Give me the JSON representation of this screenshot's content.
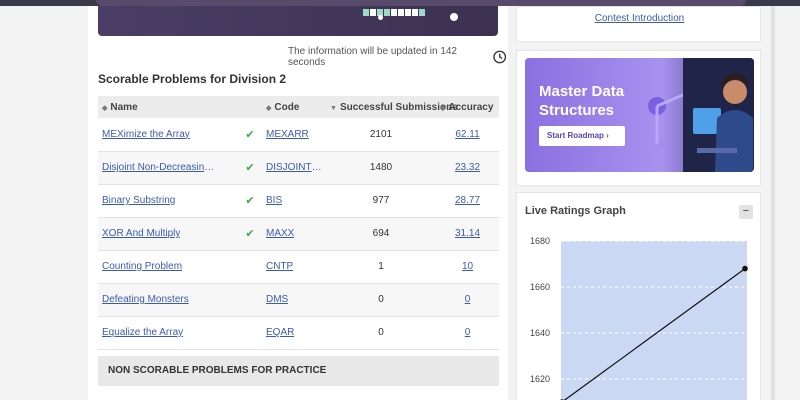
{
  "update_info": {
    "prefix": "The information will be updated in ",
    "seconds": "142",
    "suffix": " seconds"
  },
  "section_title": "Scorable Problems for Division 2",
  "table": {
    "headers": [
      "Name",
      "Code",
      "Successful Submissions",
      "Accuracy"
    ],
    "rows": [
      {
        "name": "MEXimize the Array",
        "solved": true,
        "code": "MEXARR",
        "submissions": "2101",
        "accuracy": "62.11"
      },
      {
        "name": "Disjoint Non-Decreasing Subsequences",
        "solved": true,
        "code": "DISJOINTNDS",
        "submissions": "1480",
        "accuracy": "23.32"
      },
      {
        "name": "Binary Substring",
        "solved": true,
        "code": "BIS",
        "submissions": "977",
        "accuracy": "28.77"
      },
      {
        "name": "XOR And Multiply",
        "solved": true,
        "code": "MAXX",
        "submissions": "694",
        "accuracy": "31.14"
      },
      {
        "name": "Counting Problem",
        "solved": false,
        "code": "CNTP",
        "submissions": "1",
        "accuracy": "10"
      },
      {
        "name": "Defeating Monsters",
        "solved": false,
        "code": "DMS",
        "submissions": "0",
        "accuracy": "0"
      },
      {
        "name": "Equalize the Array",
        "solved": false,
        "code": "EQAR",
        "submissions": "0",
        "accuracy": "0"
      }
    ]
  },
  "check_icon": "check-icon",
  "non_scorable_title": "NON SCORABLE PROBLEMS FOR PRACTICE",
  "contest_link": "Contest Introduction",
  "promo": {
    "title": "Master Data Structures",
    "button": "Start Roadmap"
  },
  "graph": {
    "title": "Live Ratings Graph",
    "toggle": "−",
    "y_ticks": [
      "1680",
      "1660",
      "1640",
      "1620"
    ],
    "y_min": 1600,
    "y_max": 1680,
    "points": [
      1610,
      1668
    ]
  },
  "colors": {
    "accent_link": "#3a5bb0",
    "check_green": "#3fa84a",
    "graph_fill": "#cbd8f4",
    "promo_purple": "#8a70e0"
  }
}
